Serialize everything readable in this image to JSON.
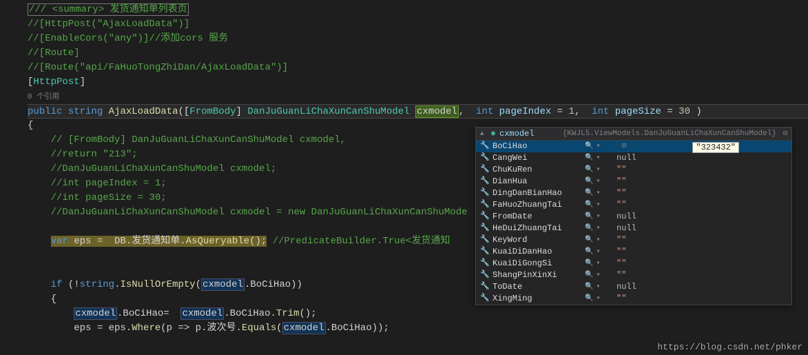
{
  "code": {
    "summary": "/// <summary> 发货通知单列表页",
    "l1": "//[HttpPost(\"AjaxLoadData\")]",
    "l2": "//[EnableCors(\"any\")]//添加cors 服务",
    "l3": "//[Route]",
    "l4": "//[Route(\"api/FaHuoTongZhiDan/AjaxLoadData\")]",
    "attr_open": "[",
    "attr_name": "HttpPost",
    "attr_close": "]",
    "refs": "0 个引用",
    "sig_public": "public",
    "sig_string": "string",
    "sig_method": "AjaxLoadData",
    "sig_p_open": "([",
    "sig_frombody": "FromBody",
    "sig_p_close_b": "]",
    "sig_type": "DanJuGuanLiChaXunCanShuModel",
    "sig_pname": "cxmodel",
    "sig_comma": ", ",
    "sig_int1": "int",
    "sig_pidx": "pageIndex",
    "sig_eq1": " = ",
    "sig_v1": "1",
    "sig_int2": "int",
    "sig_psz": "pageSize",
    "sig_v2": "30",
    "sig_close": " )",
    "brace_open": "{",
    "c1": "// [FromBody] DanJuGuanLiChaXunCanShuModel cxmodel,",
    "c2": "//return \"213\";",
    "c3": "//DanJuGuanLiChaXunCanShuModel cxmodel;",
    "c4": "//int pageIndex = 1;",
    "c5": "//int pageSize = 30;",
    "c6": "//DanJuGuanLiChaXunCanShuModel cxmodel = new DanJuGuanLiChaXunCanShuMode",
    "eps_var": "var",
    "eps_name": " eps =  DB.发货通知单.",
    "eps_asq": "AsQueryable",
    "eps_end": "();",
    "eps_comment": " //PredicateBuilder.True<发货通知",
    "if_kw": "if",
    "if_open": " (!",
    "if_string": "string",
    "if_dot": ".",
    "if_isnull": "IsNullOrEmpty",
    "if_p1": "(",
    "if_cx": "cxmodel",
    "if_prop": ".BoCiHao))",
    "brace2": "{",
    "a1_cx": "cxmodel",
    "a1_mid": ".BoCiHao=  ",
    "a1_cx2": "cxmodel",
    "a1_trim": ".BoCiHao.",
    "a1_trimname": "Trim",
    "a1_end": "();",
    "a2_pre": "eps = eps.",
    "a2_where": "Where",
    "a2_mid": "(p => p.波次号.",
    "a2_eq": "Equals",
    "a2_open": "(",
    "a2_cx": "cxmodel",
    "a2_end": ".BoCiHao));"
  },
  "tooltip": {
    "header_var": "cxmodel",
    "header_type": "{KWJL5.ViewModels.DanJuGuanLiChaXunCanShuModel}",
    "selected_value": "\"323432\"",
    "rows": [
      {
        "name": "BoCiHao",
        "value": "",
        "pin": true
      },
      {
        "name": "CangWei",
        "value": "null"
      },
      {
        "name": "ChuKuRen",
        "value": "\"\""
      },
      {
        "name": "DianHua",
        "value": "\"\""
      },
      {
        "name": "DingDanBianHao",
        "value": "\"\""
      },
      {
        "name": "FaHuoZhuangTai",
        "value": "\"\""
      },
      {
        "name": "FromDate",
        "value": "null"
      },
      {
        "name": "HeDuiZhuangTai",
        "value": "null"
      },
      {
        "name": "KeyWord",
        "value": "\"\""
      },
      {
        "name": "KuaiDiDanHao",
        "value": "\"\""
      },
      {
        "name": "KuaiDiGongSi",
        "value": "\"\""
      },
      {
        "name": "ShangPinXinXi",
        "value": "\"\""
      },
      {
        "name": "ToDate",
        "value": "null"
      },
      {
        "name": "XingMing",
        "value": "\"\""
      }
    ]
  },
  "watermark": "https://blog.csdn.net/phker"
}
